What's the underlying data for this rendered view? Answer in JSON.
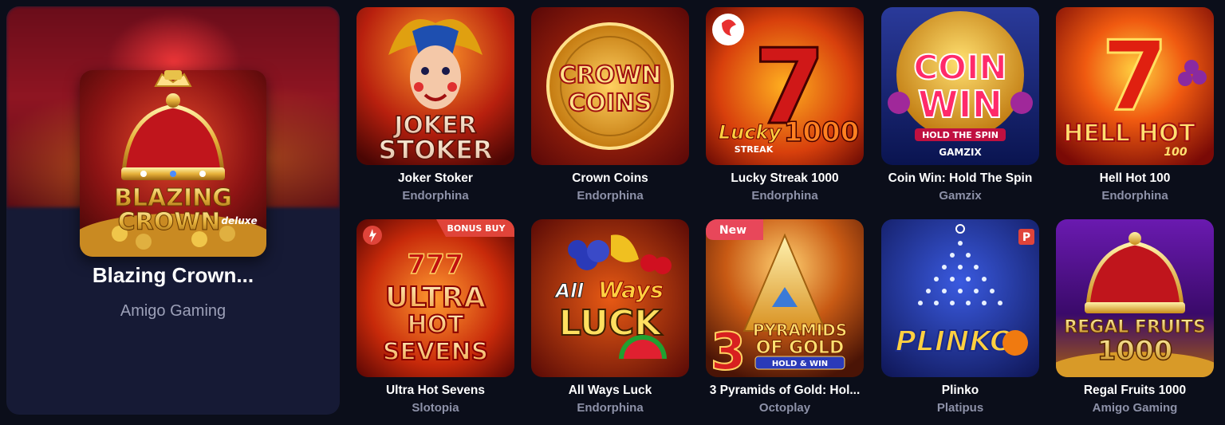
{
  "featured": {
    "title": "Blazing Crown...",
    "provider": "Amigo Gaming",
    "art_line1": "BLAZING",
    "art_line2": "CROWN",
    "art_tag": "deluxe"
  },
  "games": [
    {
      "name": "Joker Stoker",
      "provider": "Endorphina",
      "art": [
        "JOKER",
        "STOKER"
      ]
    },
    {
      "name": "Crown Coins",
      "provider": "Endorphina",
      "art": [
        "CROWN",
        "COINS"
      ]
    },
    {
      "name": "Lucky Streak 1000",
      "provider": "Endorphina",
      "art": [
        "Lucky",
        "1000",
        "STREAK"
      ]
    },
    {
      "name": "Coin Win: Hold The Spin",
      "provider": "Gamzix",
      "art": [
        "COIN",
        "WIN",
        "HOLD THE SPIN",
        "GAMZIX"
      ]
    },
    {
      "name": "Hell Hot 100",
      "provider": "Endorphina",
      "art": [
        "HELL HOT",
        "100"
      ]
    },
    {
      "name": "Ultra Hot Sevens",
      "provider": "Slotopia",
      "badge": "BONUS BUY",
      "art": [
        "ULTRA",
        "HOT",
        "SEVENS"
      ]
    },
    {
      "name": "All Ways Luck",
      "provider": "Endorphina",
      "art": [
        "All Ways",
        "LUCK"
      ]
    },
    {
      "name": "3 Pyramids of Gold: Hol...",
      "provider": "Octoplay",
      "badge": "New",
      "art": [
        "PYRAMIDS",
        "OF GOLD",
        "HOLD & WIN"
      ]
    },
    {
      "name": "Plinko",
      "provider": "Platipus",
      "badge": "P",
      "art": [
        "PLINKO"
      ]
    },
    {
      "name": "Regal Fruits 1000",
      "provider": "Amigo Gaming",
      "art": [
        "REGAL FRUITS",
        "1000"
      ]
    }
  ],
  "colors": {
    "background": "#0b0e1a",
    "featured_panel": "#161a35",
    "provider_text": "#8d91a8",
    "badge_red": "#e0443a",
    "badge_new": "#e8475a"
  }
}
